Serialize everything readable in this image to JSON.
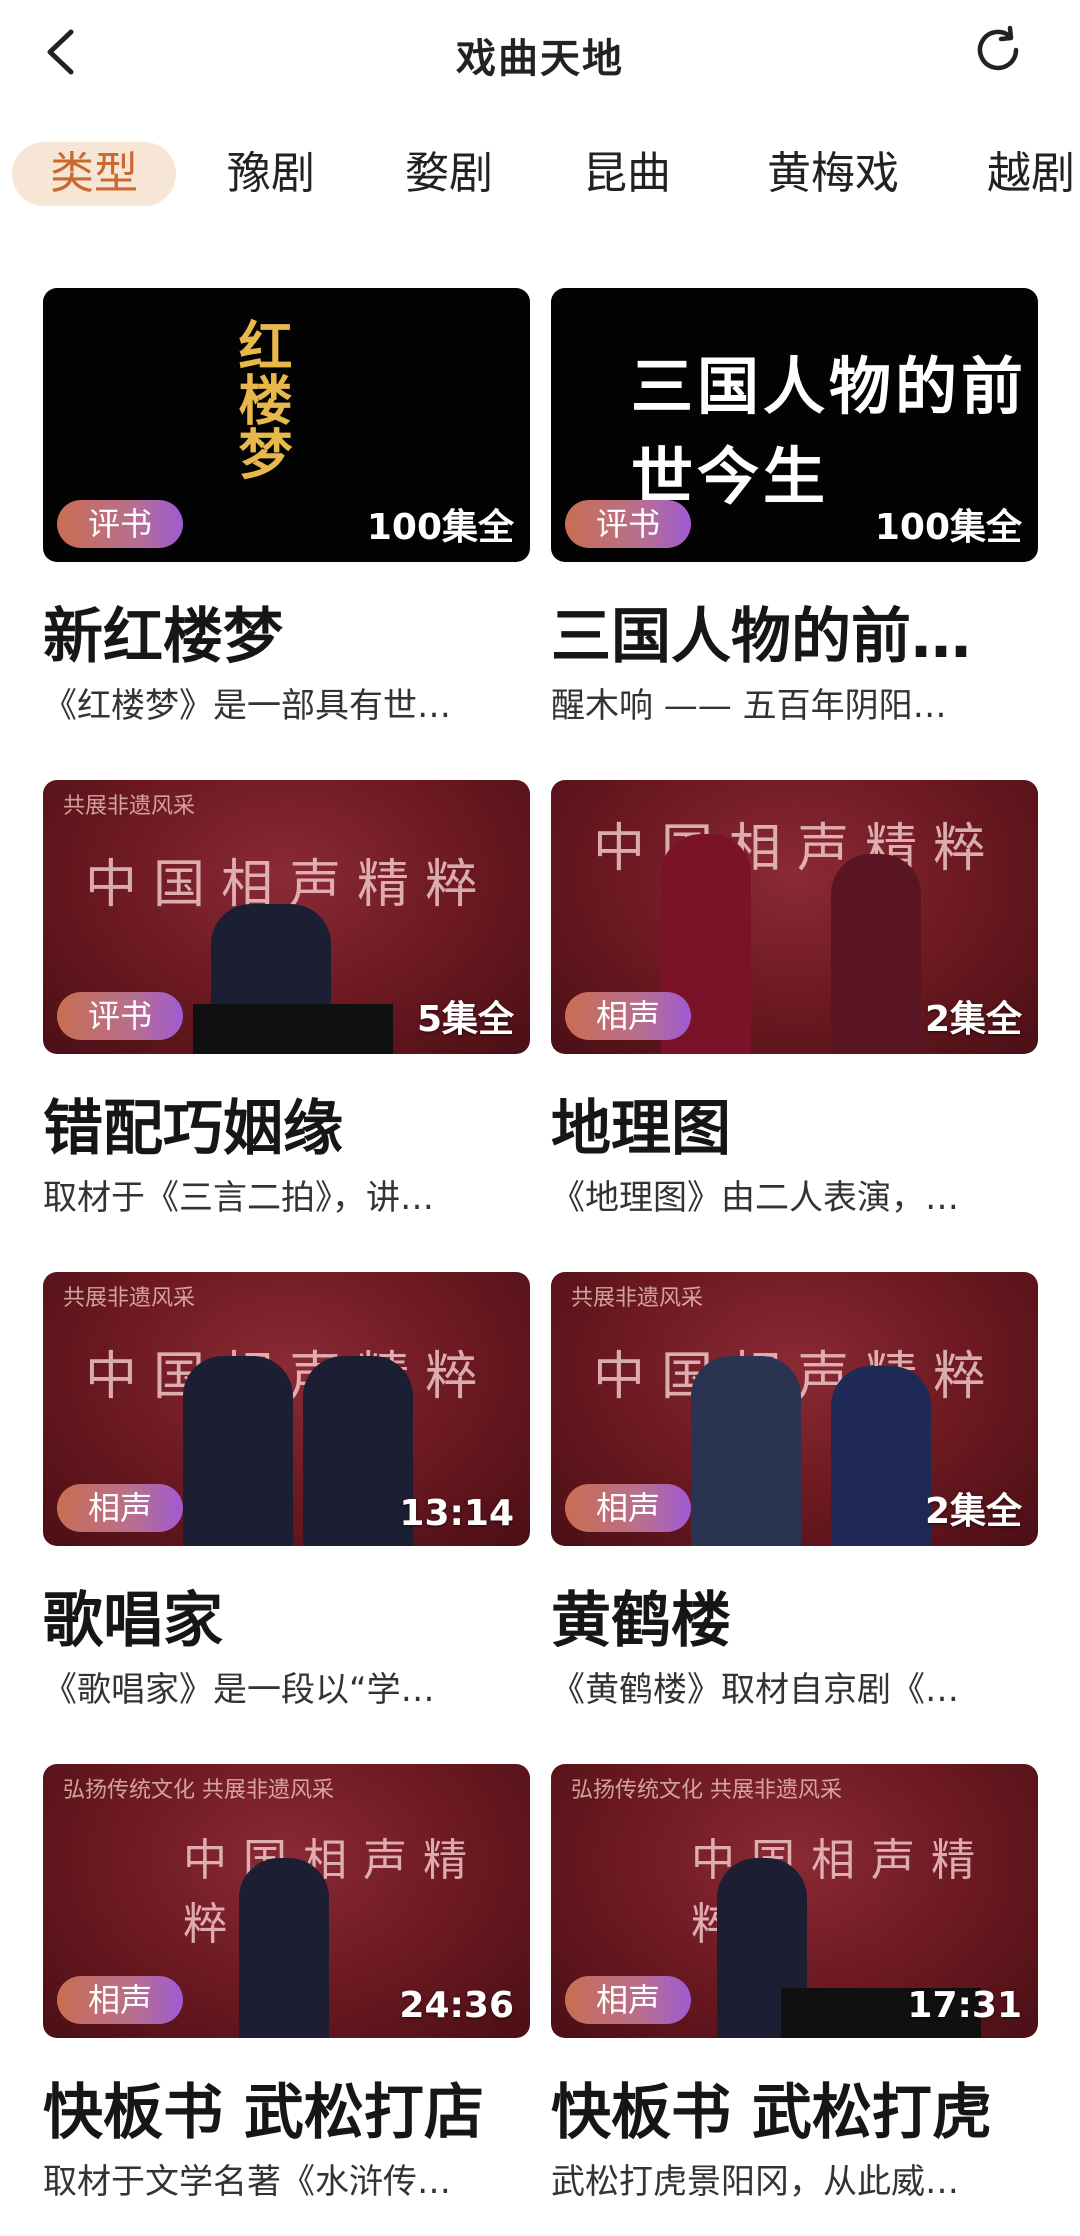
{
  "header": {
    "title": "戏曲天地"
  },
  "tabs": [
    {
      "label": "类型",
      "active": true
    },
    {
      "label": "豫剧"
    },
    {
      "label": "婺剧"
    },
    {
      "label": "昆曲"
    },
    {
      "label": "黄梅戏"
    },
    {
      "label": "越剧"
    }
  ],
  "cards": [
    {
      "badge": "评书",
      "count": "100集全",
      "title": "新红楼梦",
      "desc": "《红楼梦》是一部具有世…",
      "thumb_text": "红楼梦"
    },
    {
      "badge": "评书",
      "count": "100集全",
      "title": "三国人物的前…",
      "desc": "醒木响 —— 五百年阴阳…",
      "thumb_text": "三国人物的前世今生"
    },
    {
      "badge": "评书",
      "count": "5集全",
      "title": "错配巧姻缘",
      "desc": "取材于《三言二拍》，讲…",
      "thumb_banner": "中国相声精粹",
      "thumb_top": "共展非遗风采"
    },
    {
      "badge": "相声",
      "count": "2集全",
      "title": "地理图",
      "desc": "《地理图》由二人表演，…",
      "thumb_banner": "中国相声精粹"
    },
    {
      "badge": "相声",
      "count": "13:14",
      "title": "歌唱家",
      "desc": "《歌唱家》是一段以“学…",
      "thumb_banner": "中国相声精粹",
      "thumb_top": "共展非遗风采"
    },
    {
      "badge": "相声",
      "count": "2集全",
      "title": "黄鹤楼",
      "desc": "《黄鹤楼》取材自京剧《…",
      "thumb_banner": "中国相声精粹",
      "thumb_top": "共展非遗风采"
    },
    {
      "badge": "相声",
      "count": "24:36",
      "title": "快板书 武松打店",
      "desc": "取材于文学名著《水浒传…",
      "thumb_banner": "中国相声精粹",
      "thumb_top": "弘扬传统文化 共展非遗风采"
    },
    {
      "badge": "相声",
      "count": "17:31",
      "title": "快板书 武松打虎",
      "desc": "武松打虎景阳冈，从此威…",
      "thumb_banner": "中国相声精粹",
      "thumb_top": "弘扬传统文化 共展非遗风采"
    }
  ]
}
